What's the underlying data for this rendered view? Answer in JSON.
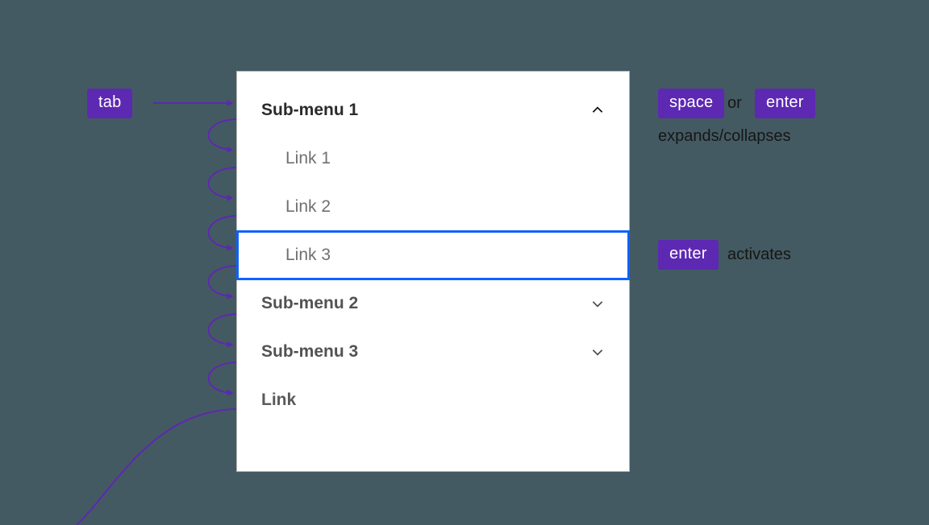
{
  "keys": {
    "tab": "tab",
    "space": "space",
    "enter": "enter",
    "enter2": "enter"
  },
  "anno": {
    "or": "or",
    "expands_collapses": "expands/collapses",
    "activates": "activates"
  },
  "menu": {
    "submenu1": "Sub-menu 1",
    "link1": "Link 1",
    "link2": "Link 2",
    "link3": "Link 3",
    "submenu2": "Sub-menu 2",
    "submenu3": "Sub-menu 3",
    "link_top": "Link"
  },
  "colors": {
    "key_bg": "#5d28b2",
    "focus_ring": "#0f62fe",
    "arrow": "#5d28b2"
  }
}
